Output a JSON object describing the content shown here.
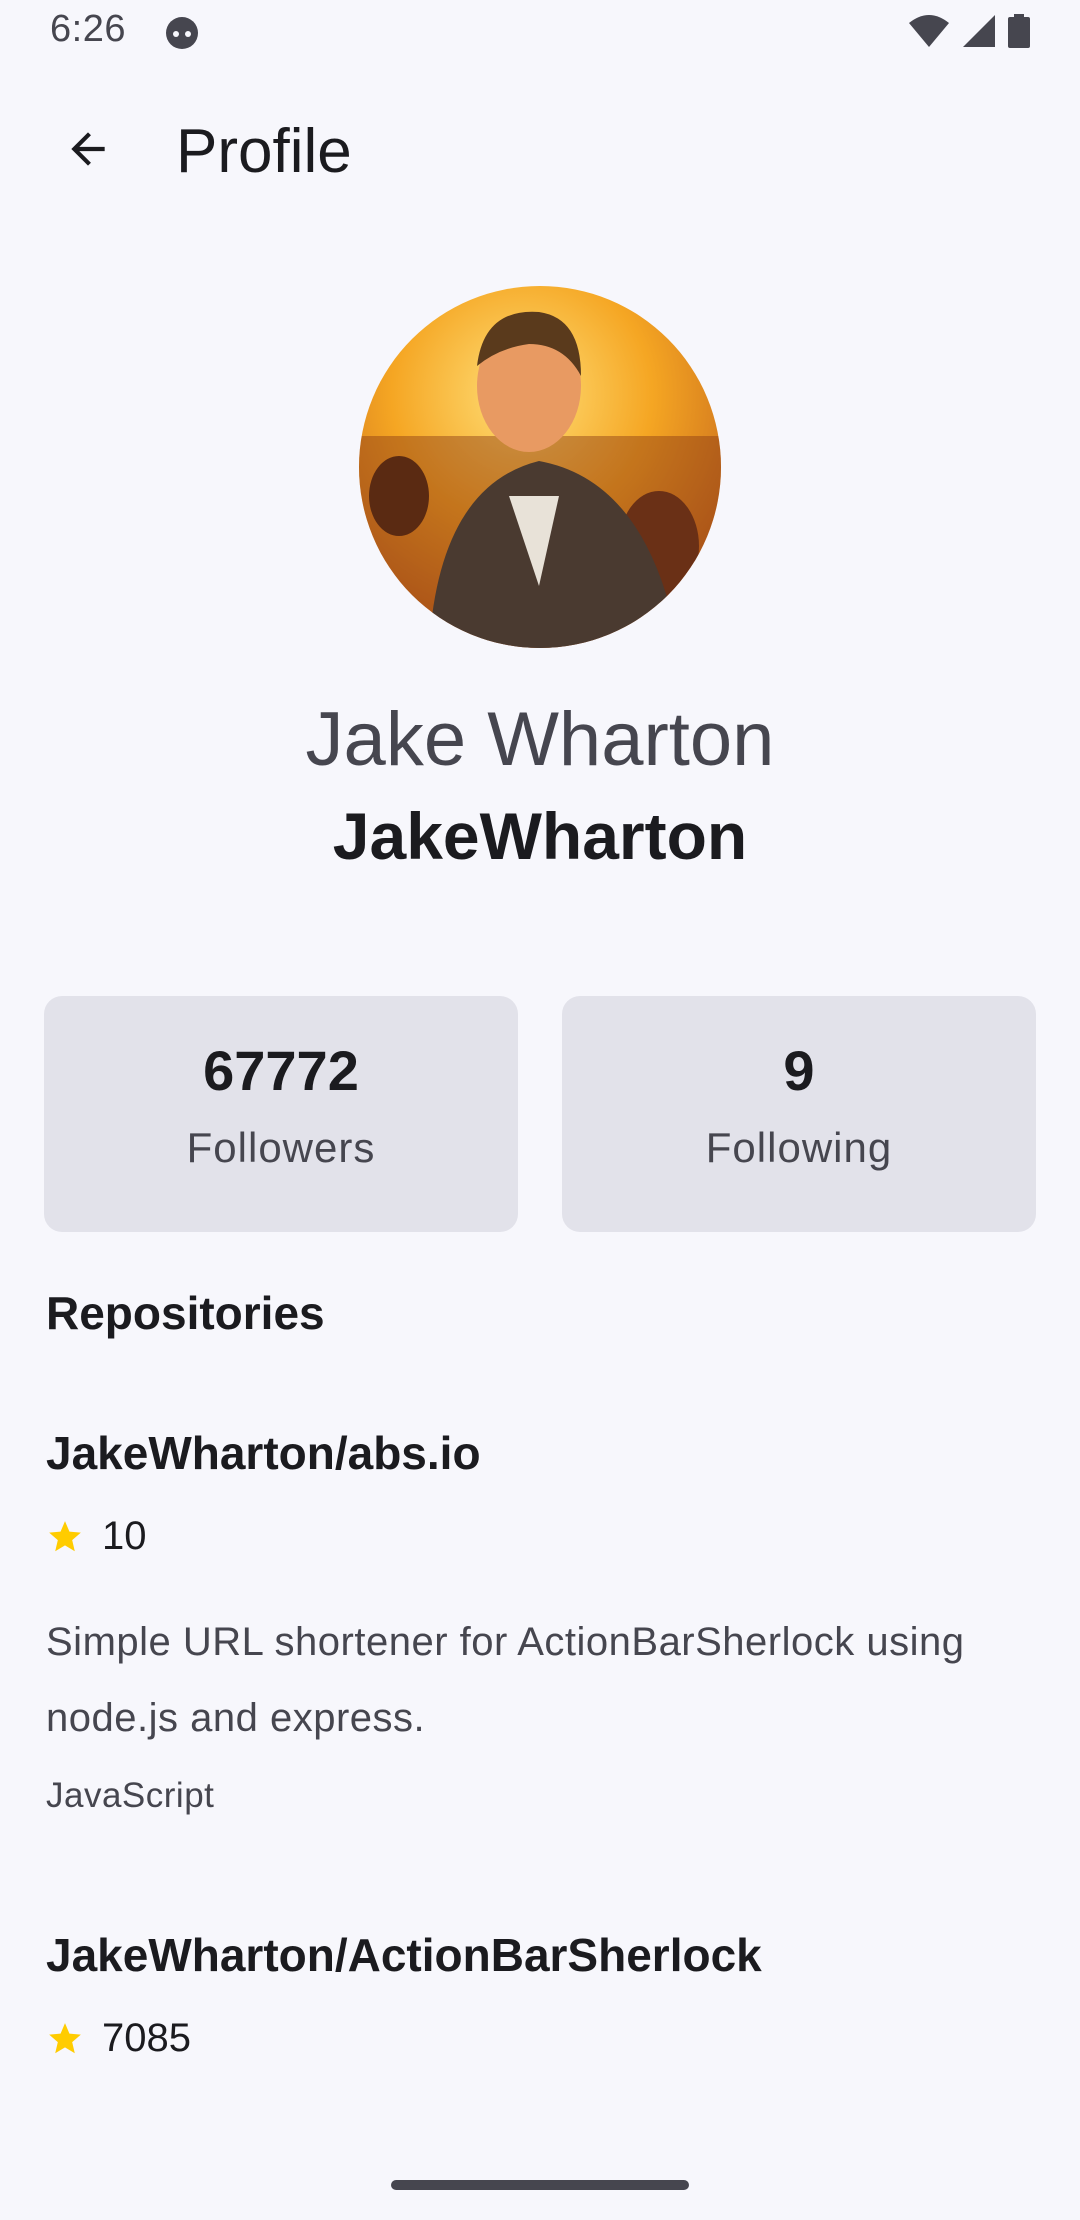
{
  "status_bar": {
    "time": "6:26",
    "icons": [
      "android-face-icon",
      "wifi-icon",
      "cell-signal-icon",
      "battery-icon"
    ]
  },
  "top_bar": {
    "back_icon": "arrow-back-icon",
    "title": "Profile"
  },
  "profile": {
    "avatar_icon": "profile-photo",
    "full_name": "Jake Wharton",
    "username": "JakeWharton"
  },
  "stats": {
    "followers_value": "67772",
    "followers_label": "Followers",
    "following_value": "9",
    "following_label": "Following"
  },
  "repositories": {
    "title": "Repositories",
    "items": [
      {
        "name": "JakeWharton/abs.io",
        "stars": "10",
        "description": "Simple URL shortener for ActionBarSherlock using node.js and express.",
        "language": "JavaScript"
      },
      {
        "name": "JakeWharton/ActionBarSherlock",
        "stars": "7085"
      }
    ]
  },
  "colors": {
    "background": "#f7f7fc",
    "card": "#e2e2ea",
    "star": "#ffcc00",
    "text_primary": "#1b1b1f",
    "text_secondary": "#46464f"
  }
}
